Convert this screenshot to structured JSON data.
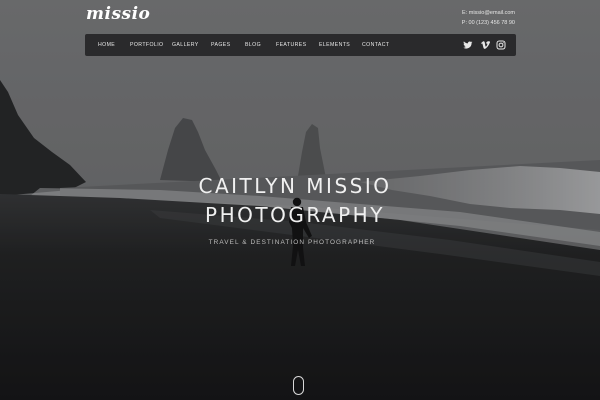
{
  "brand": {
    "logo": "missio"
  },
  "contact": {
    "email": "E: missio@email.com",
    "phone": "P: 00 (123) 456 78 90"
  },
  "nav": {
    "items": [
      {
        "label": "HOME"
      },
      {
        "label": "PORTFOLIO"
      },
      {
        "label": "GALLERY"
      },
      {
        "label": "PAGES"
      },
      {
        "label": "BLOG"
      },
      {
        "label": "FEATURES"
      },
      {
        "label": "ELEMENTS"
      },
      {
        "label": "CONTACT"
      }
    ],
    "social": [
      {
        "icon": "twitter-icon"
      },
      {
        "icon": "vimeo-icon"
      },
      {
        "icon": "instagram-icon"
      }
    ]
  },
  "hero": {
    "title_line1": "CAITLYN MISSIO",
    "title_line2": "PHOTOGRAPHY",
    "subtitle": "TRAVEL & DESTINATION PHOTOGRAPHER"
  },
  "colors": {
    "text": "#ffffff",
    "navbar": "#2a2a2c",
    "sky": "#7d7e80",
    "sand": "#1c1c1d"
  }
}
